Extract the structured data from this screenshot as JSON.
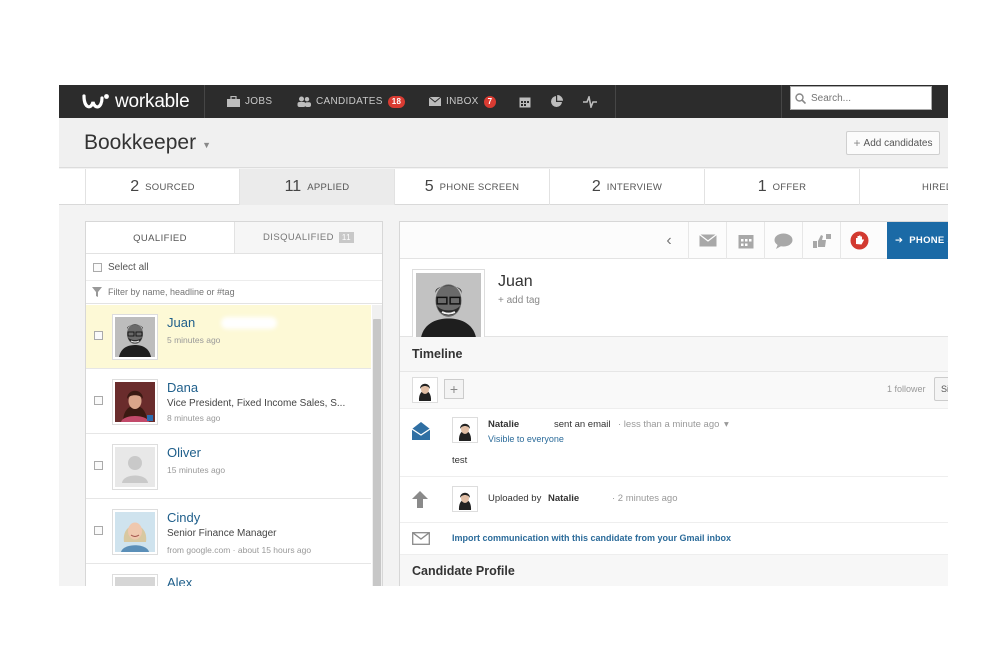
{
  "nav": {
    "brand": "workable",
    "jobs": "JOBS",
    "candidates": "CANDIDATES",
    "candidates_badge": "18",
    "inbox": "INBOX",
    "inbox_badge": "7",
    "search_placeholder": "Search..."
  },
  "job": {
    "title": "Bookkeeper",
    "add_button": "Add candidates"
  },
  "stages": [
    {
      "count": "2",
      "label": "SOURCED"
    },
    {
      "count": "11",
      "label": "APPLIED"
    },
    {
      "count": "5",
      "label": "PHONE SCREEN"
    },
    {
      "count": "2",
      "label": "INTERVIEW"
    },
    {
      "count": "1",
      "label": "OFFER"
    },
    {
      "label": "HIRED"
    }
  ],
  "list": {
    "tab_qualified": "QUALIFIED",
    "tab_disqualified": "DISQUALIFIED",
    "disqualified_badge": "11",
    "select_all": "Select all",
    "filter_placeholder": "Filter by name, headline or #tag",
    "candidates": [
      {
        "name": "Juan",
        "headline": "",
        "time": "5 minutes ago"
      },
      {
        "name": "Dana",
        "headline": "Vice President, Fixed Income Sales, S...",
        "time": "8 minutes ago"
      },
      {
        "name": "Oliver",
        "headline": "",
        "time": "15 minutes ago"
      },
      {
        "name": "Cindy",
        "headline": "Senior Finance Manager",
        "time": "from google.com · about 15 hours ago"
      },
      {
        "name": "Alex",
        "headline": "",
        "time": ""
      }
    ]
  },
  "detail": {
    "stage_button": "PHONE S",
    "name": "Juan",
    "add_tag": "add tag",
    "timeline_title": "Timeline",
    "follower_count": "1 follower",
    "follow_button": "Si",
    "email_event": {
      "actor": "Natalie",
      "action": "sent an email",
      "time": "· less than a minute ago",
      "visibility": "Visible to everyone",
      "body": "test"
    },
    "upload_event": {
      "prefix": "Uploaded by",
      "actor": "Natalie",
      "time": "· 2 minutes ago"
    },
    "import_link": "Import communication with this candidate from your Gmail inbox",
    "profile_title": "Candidate Profile"
  },
  "colors": {
    "nav_bg": "#2c2c2c",
    "badge": "#d93b32",
    "accent_blue": "#1b6aa6",
    "selected_row": "#fdf9d6",
    "link": "#1f5f8b"
  }
}
